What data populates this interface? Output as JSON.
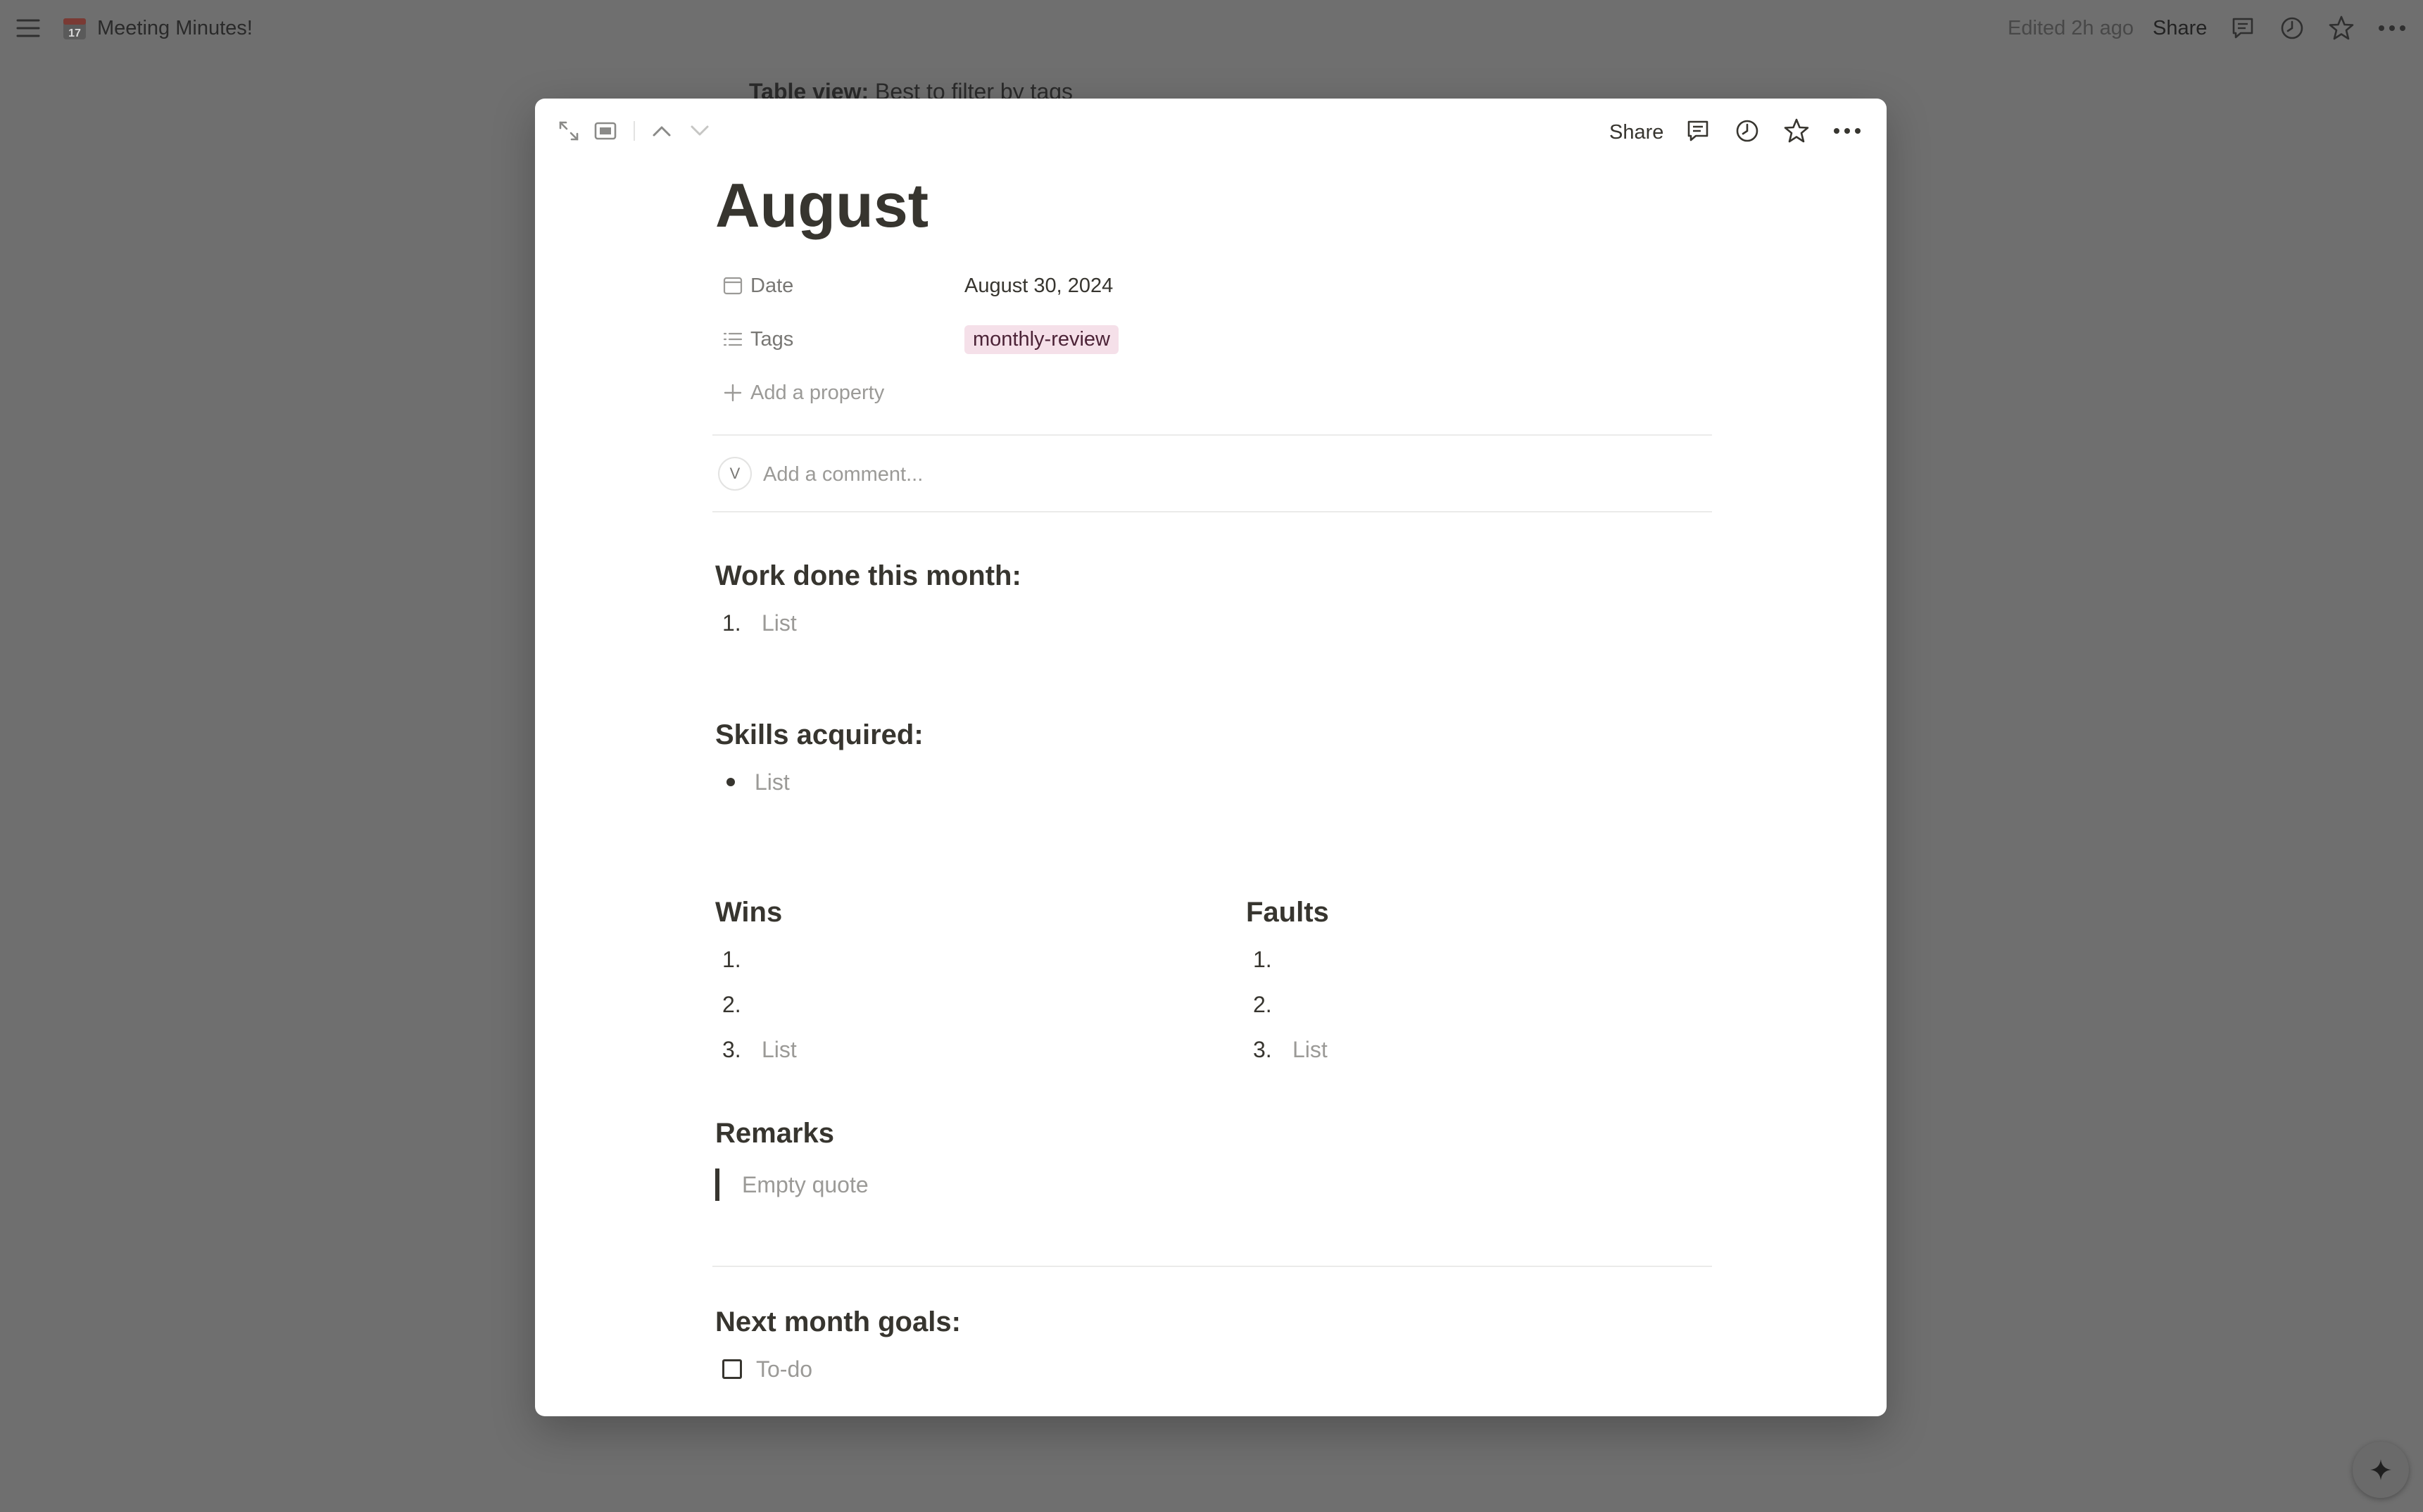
{
  "topbar": {
    "menu_icon": "menu-icon",
    "page_emoji": "calendar-icon",
    "page_title": "Meeting Minutes!",
    "edited": "Edited 2h ago",
    "share_label": "Share"
  },
  "background": {
    "obscured_line": "Table view: Best to filter by tags",
    "table_view_label": "Table view:",
    "table_view_text": "Best to filter by tags"
  },
  "modal": {
    "share_label": "Share",
    "title": "August",
    "properties": [
      {
        "label": "Date",
        "value": "August 30, 2024"
      },
      {
        "label": "Tags",
        "value": "monthly-review"
      }
    ],
    "add_property": "Add a property",
    "comment_avatar": "V",
    "comment_placeholder": "Add a comment...",
    "sections": {
      "work": {
        "heading": "Work done this month:",
        "items": [
          {
            "marker": "1.",
            "text": "List"
          }
        ]
      },
      "skills": {
        "heading": "Skills acquired:",
        "items": [
          {
            "text": "List"
          }
        ]
      },
      "wins": {
        "heading": "Wins",
        "items": [
          {
            "marker": "1.",
            "text": ""
          },
          {
            "marker": "2.",
            "text": ""
          },
          {
            "marker": "3.",
            "text": "List"
          }
        ]
      },
      "faults": {
        "heading": "Faults",
        "items": [
          {
            "marker": "1.",
            "text": ""
          },
          {
            "marker": "2.",
            "text": ""
          },
          {
            "marker": "3.",
            "text": "List"
          }
        ]
      },
      "remarks": {
        "heading": "Remarks",
        "quote_placeholder": "Empty quote"
      },
      "goals": {
        "heading": "Next month goals:",
        "todo_placeholder": "To-do",
        "todo_checked": false
      }
    }
  },
  "colors": {
    "overlay": "#6f6f6f",
    "modal_bg": "#ffffff",
    "text": "#37352f",
    "muted": "#787774",
    "placeholder": "#9b9a97",
    "tag_bg": "#f5e0e9"
  }
}
